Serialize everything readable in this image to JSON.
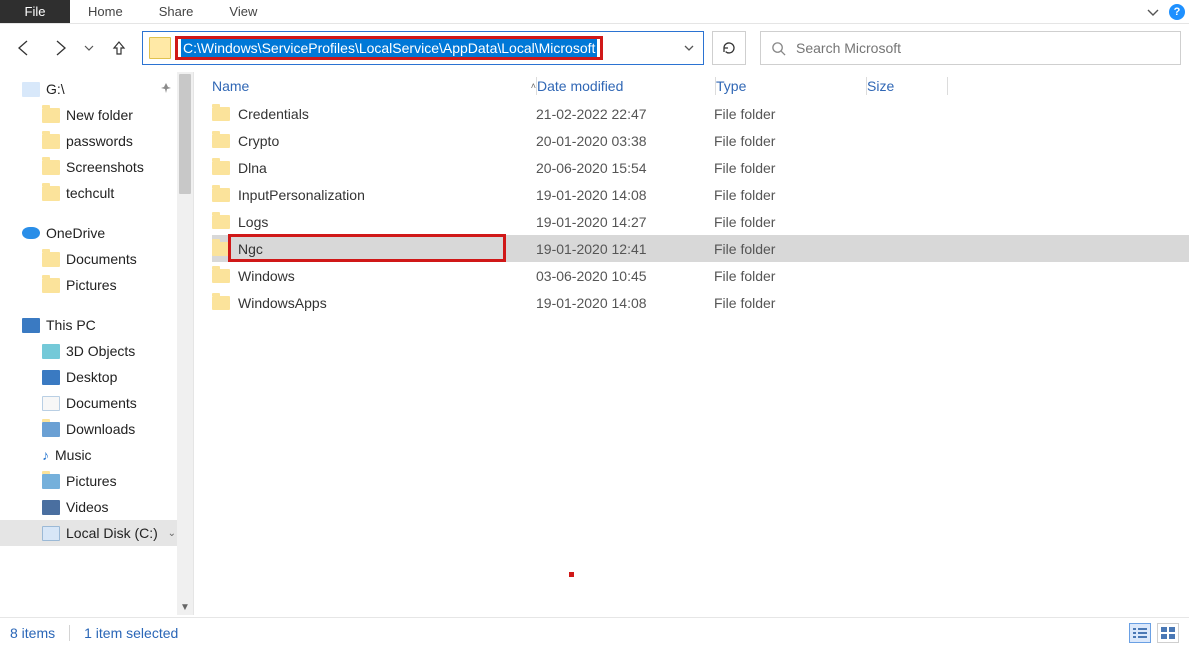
{
  "ribbon": {
    "file": "File",
    "home": "Home",
    "share": "Share",
    "view": "View",
    "help_glyph": "?"
  },
  "nav": {
    "address_path": "C:\\Windows\\ServiceProfiles\\LocalService\\AppData\\Local\\Microsoft",
    "search_placeholder": "Search Microsoft"
  },
  "sidebar": {
    "items": [
      {
        "label": "G:\\",
        "icon": "drive",
        "root": true,
        "pinned": true
      },
      {
        "label": "New folder",
        "icon": "folder",
        "child": true
      },
      {
        "label": "passwords",
        "icon": "folder",
        "child": true
      },
      {
        "label": "Screenshots",
        "icon": "folder",
        "child": true
      },
      {
        "label": "techcult",
        "icon": "folder",
        "child": true
      }
    ],
    "onedrive": {
      "label": "OneDrive"
    },
    "onedrive_children": [
      {
        "label": "Documents"
      },
      {
        "label": "Pictures"
      }
    ],
    "thispc": {
      "label": "This PC"
    },
    "thispc_children": [
      {
        "label": "3D Objects",
        "icon": "obj"
      },
      {
        "label": "Desktop",
        "icon": "pc"
      },
      {
        "label": "Documents",
        "icon": "doc"
      },
      {
        "label": "Downloads",
        "icon": "folder"
      },
      {
        "label": "Music",
        "icon": "music"
      },
      {
        "label": "Pictures",
        "icon": "folder"
      },
      {
        "label": "Videos",
        "icon": "video"
      },
      {
        "label": "Local Disk (C:)",
        "icon": "disk",
        "selected": true
      }
    ]
  },
  "columns": {
    "name": "Name",
    "date": "Date modified",
    "type": "Type",
    "size": "Size"
  },
  "rows": [
    {
      "name": "Credentials",
      "date": "21-02-2022 22:47",
      "type": "File folder"
    },
    {
      "name": "Crypto",
      "date": "20-01-2020 03:38",
      "type": "File folder"
    },
    {
      "name": "Dlna",
      "date": "20-06-2020 15:54",
      "type": "File folder"
    },
    {
      "name": "InputPersonalization",
      "date": "19-01-2020 14:08",
      "type": "File folder"
    },
    {
      "name": "Logs",
      "date": "19-01-2020 14:27",
      "type": "File folder"
    },
    {
      "name": "Ngc",
      "date": "19-01-2020 12:41",
      "type": "File folder",
      "selected": true,
      "highlighted": true
    },
    {
      "name": "Windows",
      "date": "03-06-2020 10:45",
      "type": "File folder"
    },
    {
      "name": "WindowsApps",
      "date": "19-01-2020 14:08",
      "type": "File folder"
    }
  ],
  "status": {
    "items": "8 items",
    "selected": "1 item selected"
  }
}
